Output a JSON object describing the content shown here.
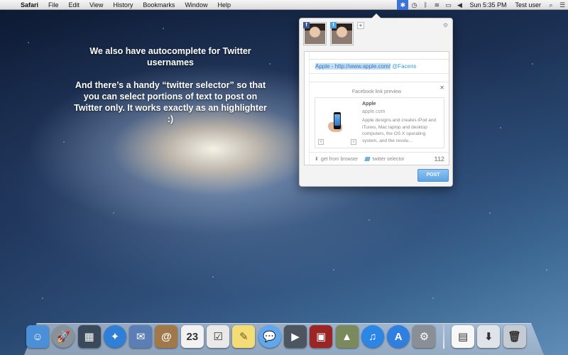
{
  "menubar": {
    "apple": "",
    "app": "Safari",
    "items": [
      "File",
      "Edit",
      "View",
      "History",
      "Bookmarks",
      "Window",
      "Help"
    ],
    "clock": "Sun 5:35 PM",
    "user": "Test user"
  },
  "caption": {
    "line1": "We also have autocomplete for Twitter usernames",
    "line2": "And there’s a handy “twitter selector” so that you can select portions of text to post on Twitter only. It works exactly as an highlighter :)"
  },
  "popover": {
    "accounts": [
      {
        "network": "facebook",
        "badge": "f"
      },
      {
        "network": "twitter",
        "badge": "t"
      }
    ],
    "add_label": "+",
    "settings_icon": "gear-icon",
    "compose": {
      "link_text": "Apple - http://www.apple.com/",
      "mention": "@Facens"
    },
    "preview": {
      "heading": "Facebook link preview",
      "close": "✕",
      "title": "Apple",
      "domain": "apple.com",
      "description": "Apple designs and creates iPod and iTunes, Mac laptop and desktop computers, the OS X operating system, and the revolu...",
      "prev": "‹",
      "next": "›"
    },
    "footer": {
      "get_from_browser": "get from browser",
      "twitter_selector": "twitter selector",
      "count": "112"
    },
    "post_label": "POST"
  },
  "dock": {
    "apps": [
      {
        "name": "finder",
        "color": "#4a8fd8",
        "glyph": "☺"
      },
      {
        "name": "launchpad",
        "color": "#8a9299",
        "glyph": "🚀"
      },
      {
        "name": "mission-control",
        "color": "#3a4a5a",
        "glyph": "▦"
      },
      {
        "name": "safari",
        "color": "#2f7fd6",
        "glyph": "✦"
      },
      {
        "name": "mail",
        "color": "#5b7fb4",
        "glyph": "✉"
      },
      {
        "name": "contacts",
        "color": "#a0784a",
        "glyph": "@"
      },
      {
        "name": "calendar",
        "color": "#f2f2f2",
        "glyph": "23"
      },
      {
        "name": "reminders",
        "color": "#e9e9e9",
        "glyph": "☑"
      },
      {
        "name": "notes",
        "color": "#f4dd76",
        "glyph": "✎"
      },
      {
        "name": "messages",
        "color": "#5fa8ef",
        "glyph": "💬"
      },
      {
        "name": "facetime",
        "color": "#4c5560",
        "glyph": "▶"
      },
      {
        "name": "photo-booth",
        "color": "#9b2424",
        "glyph": "▣"
      },
      {
        "name": "iphoto",
        "color": "#7a8a5a",
        "glyph": "▲"
      },
      {
        "name": "itunes",
        "color": "#2c86e6",
        "glyph": "♫"
      },
      {
        "name": "app-store",
        "color": "#2f7fe0",
        "glyph": "A"
      },
      {
        "name": "system-preferences",
        "color": "#8a8f96",
        "glyph": "⚙"
      }
    ],
    "right": [
      {
        "name": "document",
        "color": "#f7f7f7",
        "glyph": "▤"
      },
      {
        "name": "downloads",
        "color": "#dfe4ea",
        "glyph": "⬇"
      },
      {
        "name": "trash",
        "color": "#c5cbd2",
        "glyph": "🗑"
      }
    ]
  }
}
